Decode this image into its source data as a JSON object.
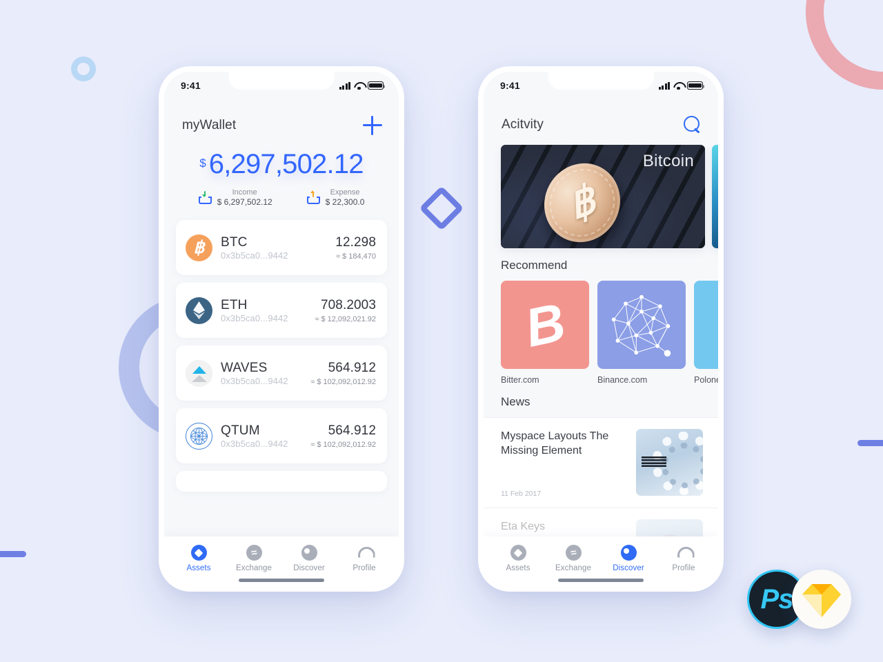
{
  "colors": {
    "page_bg": "#e8ecfb",
    "accent_blue": "#3366ff",
    "tab_inactive": "#9196a1",
    "deco_pink": "#eba9b2",
    "deco_purple": "#b7c2ee",
    "deco_light_blue": "#b8d8f5",
    "deco_indigo": "#6e7fe4"
  },
  "wallet": {
    "status": {
      "time": "9:41",
      "signal_icon": "signal-bars-icon",
      "wifi_icon": "wifi-icon",
      "battery_icon": "battery-icon"
    },
    "header": {
      "title": "myWallet",
      "add_icon": "plus-icon"
    },
    "balance": {
      "currency": "$",
      "amount": "6,297,502.12"
    },
    "summary": [
      {
        "label": "Income",
        "value": "$ 6,297,502.12",
        "icon": "income-tray-down-arrow-icon"
      },
      {
        "label": "Expense",
        "value": "$ 22,300.0",
        "icon": "expense-tray-up-arrow-icon"
      }
    ],
    "assets": [
      {
        "symbol": "BTC",
        "address": "0x3b5ca0...9442",
        "amount": "12.298",
        "usd": "≈ $ 184,470",
        "icon": "bitcoin-coin-icon"
      },
      {
        "symbol": "ETH",
        "address": "0x3b5ca0...9442",
        "amount": "708.2003",
        "usd": "≈ $ 12,092,021.92",
        "icon": "ethereum-coin-icon"
      },
      {
        "symbol": "WAVES",
        "address": "0x3b5ca0...9442",
        "amount": "564.912",
        "usd": "≈ $ 102,092,012.92",
        "icon": "waves-coin-icon"
      },
      {
        "symbol": "QTUM",
        "address": "0x3b5ca0...9442",
        "amount": "564.912",
        "usd": "≈ $ 102,092,012.92",
        "icon": "qtum-coin-icon"
      }
    ],
    "tabs": [
      {
        "label": "Assets",
        "icon": "assets-icon",
        "active": true
      },
      {
        "label": "Exchange",
        "icon": "exchange-icon",
        "active": false
      },
      {
        "label": "Discover",
        "icon": "discover-icon",
        "active": false
      },
      {
        "label": "Profile",
        "icon": "profile-icon",
        "active": false
      }
    ]
  },
  "discover": {
    "status": {
      "time": "9:41",
      "signal_icon": "signal-bars-icon",
      "wifi_icon": "wifi-icon",
      "battery_icon": "battery-icon"
    },
    "header": {
      "title": "Acitvity",
      "search_icon": "search-icon"
    },
    "hero": {
      "label": "Bitcoin",
      "image_alt": "bitcoin-coin-on-keyboard-photo"
    },
    "recommend": {
      "title": "Recommend",
      "items": [
        {
          "name": "Bitter.com",
          "icon": "bitcoin-b-glyph-icon",
          "color": "#f3958f"
        },
        {
          "name": "Binance.com",
          "icon": "network-graph-icon",
          "color": "#8b9ee6"
        },
        {
          "name": "Polone",
          "icon": "poloniex-icon",
          "color": "#73c8f0"
        }
      ]
    },
    "news": {
      "title": "News",
      "items": [
        {
          "title": "Myspace Layouts The Missing Element",
          "date": "11 Feb 2017",
          "thumb": "ibm-server-photo"
        },
        {
          "title": "Eta Keys",
          "date": "",
          "thumb": "avatar-photo"
        }
      ]
    },
    "tabs": [
      {
        "label": "Assets",
        "icon": "assets-icon",
        "active": false
      },
      {
        "label": "Exchange",
        "icon": "exchange-icon",
        "active": false
      },
      {
        "label": "Discover",
        "icon": "discover-icon",
        "active": true
      },
      {
        "label": "Profile",
        "icon": "profile-icon",
        "active": false
      }
    ]
  },
  "badges": {
    "photoshop": {
      "label": "Ps",
      "name": "photoshop-badge"
    },
    "sketch": {
      "label": "",
      "name": "sketch-badge"
    }
  }
}
